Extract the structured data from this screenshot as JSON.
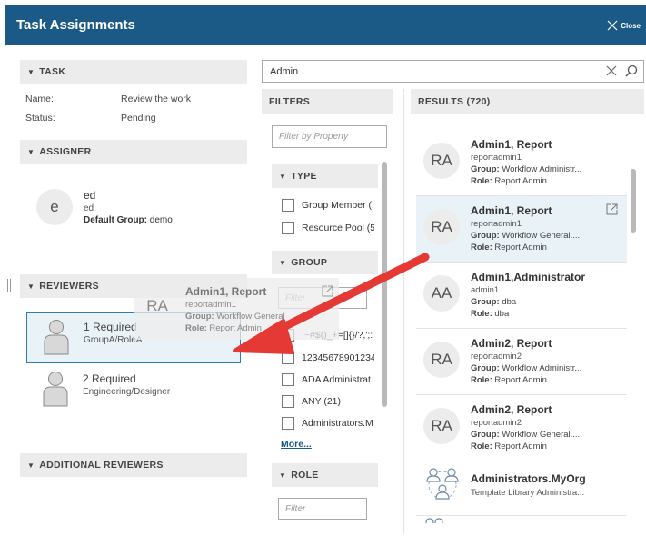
{
  "window": {
    "title": "Task Assignments",
    "close_label": "Close"
  },
  "task": {
    "header": "TASK",
    "fields": [
      {
        "label": "Name:",
        "value": "Review the work"
      },
      {
        "label": "Status:",
        "value": "Pending"
      }
    ]
  },
  "assigner": {
    "header": "ASSIGNER",
    "avatar_letter": "e",
    "name": "ed",
    "id": "ed",
    "group_label": "Default Group:",
    "group_value": "demo"
  },
  "reviewers": {
    "header": "REVIEWERS",
    "items": [
      {
        "count": "1 Required",
        "role": "GroupA/RoleA"
      },
      {
        "count": "2 Required",
        "role": "Engineering/Designer"
      }
    ]
  },
  "additional_reviewers": {
    "header": "ADDITIONAL REVIEWERS"
  },
  "search": {
    "value": "Admin"
  },
  "filters": {
    "header": "FILTERS",
    "property_placeholder": "Filter by Property",
    "type": {
      "header": "TYPE",
      "items": [
        "Group Member (",
        "Resource Pool (5"
      ]
    },
    "group": {
      "header": "GROUP",
      "filter_placeholder": "Filter",
      "items": [
        "!~#$()_+=[]{}/?,';:",
        "12345678901234",
        "ADA Administrat",
        "ANY (21)",
        "Administrators.M"
      ],
      "more_label": "More..."
    },
    "role": {
      "header": "ROLE",
      "filter_placeholder": "Filter"
    }
  },
  "results": {
    "header": "RESULTS (720)",
    "group_label": "Group:",
    "role_label": "Role:",
    "items": [
      {
        "initials": "RA",
        "name": "Admin1, Report",
        "id": "reportadmin1",
        "group": "Workflow Administr...",
        "role": "Report Admin"
      },
      {
        "initials": "RA",
        "name": "Admin1, Report",
        "id": "reportadmin1",
        "group": "Workflow General....",
        "role": "Report Admin"
      },
      {
        "initials": "AA",
        "name": "Admin1,Administrator",
        "id": "admin1",
        "group": "dba",
        "role": "dba"
      },
      {
        "initials": "RA",
        "name": "Admin2, Report",
        "id": "reportadmin2",
        "group": "Workflow Administr...",
        "role": "Report Admin"
      },
      {
        "initials": "RA",
        "name": "Admin2, Report",
        "id": "reportadmin2",
        "group": "Workflow General....",
        "role": "Report Admin"
      },
      {
        "name": "Administrators.MyOrg",
        "id": "Template Library Administra..."
      }
    ]
  },
  "drag_ghost": {
    "initials": "RA",
    "name": "Admin1, Report",
    "id": "reportadmin1",
    "group": "Workflow General",
    "role": "Report Admin"
  },
  "colors": {
    "titlebar": "#1b5a86",
    "arrow": "#e53935",
    "selection_border": "#2a7fb0",
    "selection_bg": "#e9f2f7"
  }
}
